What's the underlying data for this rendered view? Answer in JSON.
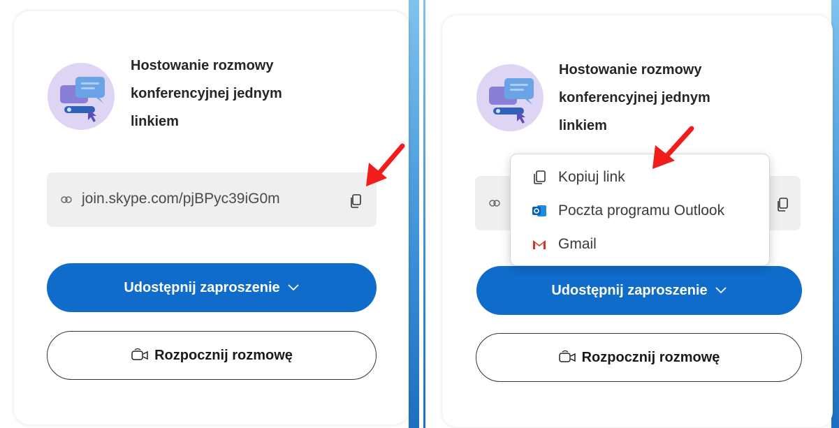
{
  "colors": {
    "primary_button": "#0f6ccb",
    "arrow": "#f11d1d",
    "illustration_bg": "#ddd5f3",
    "link_box_bg": "#efefef"
  },
  "left_panel": {
    "title": "Hostowanie rozmowy konferencyjnej jednym linkiem",
    "link_text": "join.skype.com/pjBPyc39iG0m",
    "share_button_label": "Udostępnij zaproszenie",
    "start_call_label": "Rozpocznij rozmowę",
    "icons": {
      "illustration": "chat-link-illustration",
      "link": "link-icon",
      "copy": "copy-icon",
      "chevron": "chevron-down-icon",
      "video": "video-call-icon"
    }
  },
  "right_panel": {
    "title": "Hostowanie rozmowy konferencyjnej jednym linkiem",
    "share_button_label": "Udostępnij zaproszenie",
    "start_call_label": "Rozpocznij rozmowę",
    "share_menu": {
      "items": [
        {
          "label": "Kopiuj link",
          "icon": "copy-icon"
        },
        {
          "label": "Poczta programu Outlook",
          "icon": "outlook-icon"
        },
        {
          "label": "Gmail",
          "icon": "gmail-icon"
        }
      ]
    }
  },
  "annotations": {
    "arrow_icon": "red-arrow-icon"
  }
}
